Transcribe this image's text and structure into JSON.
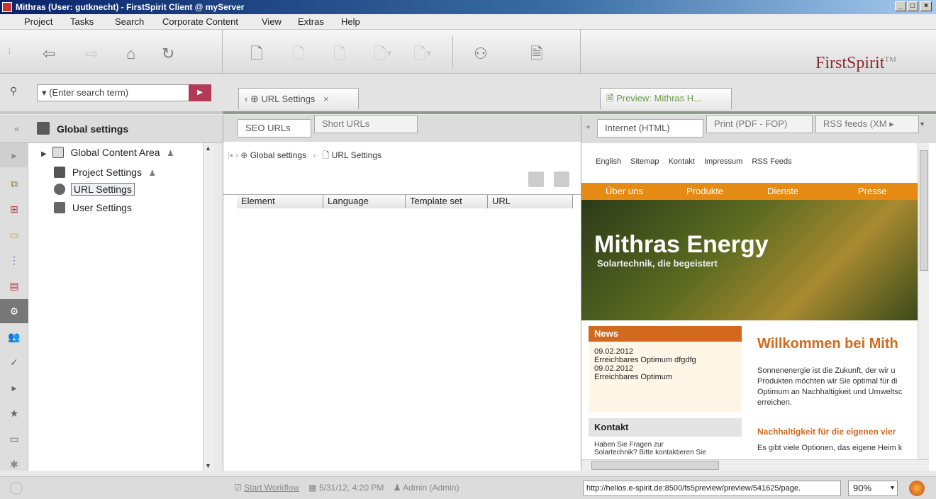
{
  "window": {
    "title": "Mithras (User: gutknecht) - FirstSpirit Client @ myServer"
  },
  "menu": [
    "Project",
    "Tasks",
    "Search",
    "Corporate Content",
    "View",
    "Extras",
    "Help"
  ],
  "brand": "FirstSpirit",
  "brand_tm": "TM",
  "search": {
    "placeholder": "(Enter search term)"
  },
  "tree": {
    "header": "Global settings",
    "items": [
      {
        "label": "Global Content Area"
      },
      {
        "label": "Project Settings"
      },
      {
        "label": "URL Settings"
      },
      {
        "label": "User Settings"
      }
    ]
  },
  "center": {
    "tab_label": "URL Settings",
    "subtabs": [
      "SEO URLs",
      "Short URLs"
    ],
    "breadcrumb": [
      "Global settings",
      "URL Settings"
    ],
    "columns": [
      "Element",
      "Language",
      "Template set",
      "URL"
    ]
  },
  "preview": {
    "tab_label": "Preview: Mithras H...",
    "subtabs": [
      "Internet (HTML)",
      "Print (PDF - FOP)",
      "RSS feeds (XM"
    ],
    "toplinks": [
      "English",
      "Sitemap",
      "Kontakt",
      "Impressum",
      "RSS Feeds"
    ],
    "nav": [
      "Über uns",
      "Produkte",
      "Dienste",
      "Presse"
    ],
    "hero_title": "Mithras Energy",
    "hero_sub": "Solartechnik, die begeistert",
    "news": {
      "title": "News",
      "items": [
        "09.02.2012",
        "Erreichbares Optimum dfgdfg",
        "09.02.2012",
        "Erreichbares Optimum"
      ]
    },
    "kontakt": {
      "title": "Kontakt",
      "lines": [
        "Haben Sie Fragen zur",
        "Solartechnik? Bitte kontaktieren Sie"
      ]
    },
    "welcome": "Willkommen bei Mith",
    "body": [
      "Sonnenenergie ist die Zukunft, der wir u",
      "Produkten möchten wir Sie optimal für di",
      "Optimum an Nachhaltigkeit und Umweltsc",
      "erreichen."
    ],
    "sub_heading": "Nachhaltigkeit für die eigenen vier",
    "body2": "Es gibt viele Optionen, das eigene Heim k",
    "url": "http://helios.e-spirit.de:8500/fs5preview/preview/541625/page.",
    "zoom": "90%"
  },
  "statusbar": {
    "workflow": "Start Workflow",
    "date": "5/31/12, 4:20 PM",
    "user": "Admin (Admin)"
  }
}
